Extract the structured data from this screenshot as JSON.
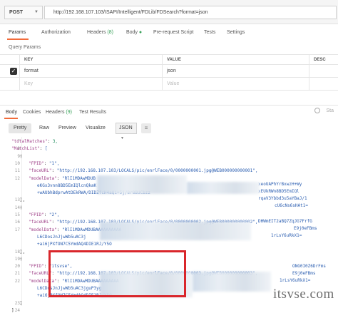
{
  "request": {
    "method": "POST",
    "url": "http://192.168.107.103/ISAPI/Intelligent/FDLib/FDSearch?format=json"
  },
  "request_tabs": [
    {
      "label": "Params",
      "badge": "",
      "active": true
    },
    {
      "label": "Authorization",
      "badge": "",
      "active": false
    },
    {
      "label": "Headers",
      "badge": "(8)",
      "active": false
    },
    {
      "label": "Body",
      "badge": "",
      "active": false
    },
    {
      "label": "Pre-request Script",
      "badge": "",
      "active": false
    },
    {
      "label": "Tests",
      "badge": "",
      "active": false
    },
    {
      "label": "Settings",
      "badge": "",
      "active": false
    }
  ],
  "query_params": {
    "label": "Query Params",
    "headers": [
      "KEY",
      "VALUE",
      "DESC"
    ],
    "rows": [
      {
        "checked": true,
        "key": "format",
        "value": "json"
      },
      {
        "checked": false,
        "key": "Key",
        "value": "Value",
        "placeholder": true
      }
    ]
  },
  "response_tabs": [
    {
      "label": "Body",
      "badge": "",
      "active": true
    },
    {
      "label": "Cookies",
      "badge": "",
      "active": false
    },
    {
      "label": "Headers",
      "badge": "(9)",
      "active": false
    },
    {
      "label": "Test Results",
      "badge": "",
      "active": false
    }
  ],
  "status_text": "Sta",
  "view_buttons": [
    "Pretty",
    "Raw",
    "Preview",
    "Visualize"
  ],
  "format_select": "JSON",
  "code_lines": [
    {
      "n": "7",
      "text": "\"totalMatches\": 3,"
    },
    {
      "n": "8",
      "text": "\"MatchList\": ["
    },
    {
      "n": "9",
      "text": "{"
    },
    {
      "n": "10",
      "text": "\"FPID\": \"1\","
    },
    {
      "n": "11",
      "text": "\"faceURL\": \"http://192.168.107.103/LOCALS/pic/enrlFace/0/0000000001.jpg@WEB000000000001\","
    },
    {
      "n": "12",
      "text": "\"modelData\": \"RlI1MDAwMDUB"
    },
    {
      "n": "",
      "text": "eKGx3vnn8BD5EmIQlcnQkaK"
    },
    {
      "n": "",
      "text": "+wAUbhBdprwAtDEkRWA/DIDZfcH4aQi+5j/8r8BUCbzz"
    },
    {
      "n": "13",
      "text": "},"
    },
    {
      "n": "14",
      "text": "{"
    },
    {
      "n": "15",
      "text": "\"FPID\": \"2\","
    },
    {
      "n": "16",
      "text": "\"faceURL\": \"http://192.168.107.103/LOCALS/pic/enrlFace/0/0000000002.jpg@WEB000000000002\","
    },
    {
      "n": "17",
      "text": "\"modelData\": \"RlI1MDAwMDUBAAAAAAAAAA"
    },
    {
      "n": "",
      "text": "L6CDosJnJjwWb5uAC3j"
    },
    {
      "n": "",
      "text": "+ai6jPXfON7C5YmdAQ4DIE1RJ/Y5O"
    },
    {
      "n": "18",
      "text": "},"
    },
    {
      "n": "19",
      "text": "{"
    },
    {
      "n": "20",
      "text": "\"FPID\": \"itsvse\","
    },
    {
      "n": "21",
      "text": "\"faceURL\": \"http://192.168.107.103/LOCALS/pic/enrlFace/0/0000000003.jpg@WEB000000000003\","
    },
    {
      "n": "22",
      "text": "\"modelData\": \"RlI1MDAwMDUBAAAAAAAAA"
    },
    {
      "n": "",
      "text": "L6CDosJnJjwWb5uAC3jguP3yg"
    },
    {
      "n": "",
      "text": "+ai6jPXfON7C5YmdAQ4DIE1RJ/Y5O"
    },
    {
      "n": "23",
      "text": "}"
    },
    {
      "n": "24",
      "text": "]"
    }
  ],
  "code_right_fragments": [
    {
      "line": "11",
      "text": ""
    },
    {
      "line": "12a",
      "text": "xeoUAPhYrBxwzH+Wy"
    },
    {
      "line": "12b",
      "text": "xEUkRWn8BD5EmIQl"
    },
    {
      "line": "12c",
      "text": "rqaV3Ybbd3u5aYBaJ/1"
    },
    {
      "line": "12d",
      "text": "cU6cNs6sHAt1="
    },
    {
      "line": "17a",
      "text": "DHWmEIT2aBQ7ZqJG7FrfG"
    },
    {
      "line": "17b",
      "text": "E9j0eFBms"
    },
    {
      "line": "17c",
      "text": "1rLsY6uRkX1="
    },
    {
      "line": "22a",
      "text": "ONG0I0Z6DrFms"
    },
    {
      "line": "22b",
      "text": "E9j0eFBms"
    },
    {
      "line": "22c",
      "text": "1rLsY6uRkX1="
    }
  ],
  "watermark": "itsvse.com"
}
